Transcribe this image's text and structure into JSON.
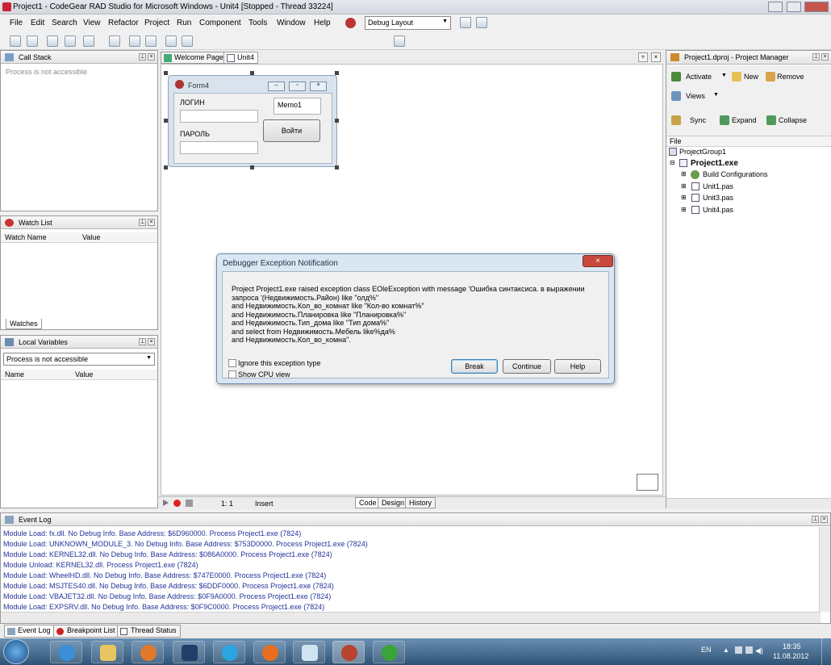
{
  "app": {
    "title": "Project1 - CodeGear RAD Studio for Microsoft Windows - Unit4 [Stopped - Thread 33224]"
  },
  "menu": [
    "File",
    "Edit",
    "Search",
    "View",
    "Refactor",
    "Project",
    "Run",
    "Component",
    "Tools",
    "Window",
    "Help"
  ],
  "layout_combo": "Debug Layout",
  "call_stack": {
    "title": "Call Stack",
    "message": "Process is not accessible"
  },
  "watch_list": {
    "title": "Watch List",
    "col_name": "Watch Name",
    "col_value": "Value",
    "tab": "Watches"
  },
  "local_vars": {
    "title": "Local Variables",
    "combo": "Process is not accessible",
    "col_name": "Name",
    "col_value": "Value"
  },
  "editor_tabs": {
    "welcome": "Welcome Page",
    "unit": "Unit4"
  },
  "form": {
    "title": "Form4",
    "login_label": "ЛОГИН",
    "password_label": "ПАРОЛЬ",
    "memo": "Memo1",
    "button": "Войти"
  },
  "editor_status": {
    "position": "1:   1",
    "mode": "Insert",
    "tab_code": "Code",
    "tab_design": "Design",
    "tab_history": "History"
  },
  "dialog": {
    "title": "Debugger Exception Notification",
    "lines": [
      "Project Project1.exe raised exception class EOleException with message 'Ошибка синтаксиса. в выражении",
      "запроса '(Недвижимость.Район) like \"олд%\"",
      "and Недвижимость.Кол_во_комнат like \"Кол-во комнат%\"",
      "and Недвижимость.Планировка like \"Планировка%\"",
      "and Недвижимость.Тип_дома like \"Тип дома%\"",
      "and select from Недвижимость.Мебель like%да%",
      "and Недвижимость.Кол_во_комна\"."
    ],
    "ignore_label": "Ignore this exception type",
    "cpu_label": "Show CPU view",
    "break": "Break",
    "continue": "Continue",
    "help": "Help"
  },
  "project_manager": {
    "title": "Project1.dproj - Project Manager",
    "activate": "Activate",
    "new": "New",
    "remove": "Remove",
    "views": "Views",
    "sync": "Sync",
    "expand": "Expand",
    "collapse": "Collapse",
    "col_file": "File",
    "tree": {
      "group": "ProjectGroup1",
      "project": "Project1.exe",
      "build": "Build Configurations",
      "u1": "Unit1.pas",
      "u3": "Unit3.pas",
      "u4": "Unit4.pas"
    }
  },
  "event_log": {
    "title": "Event Log",
    "lines": [
      "Module Load: fx.dll. No Debug Info. Base Address: $6D960000. Process Project1.exe (7824)",
      "Module Load: UNKNOWN_MODULE_3. No Debug Info. Base Address: $753D0000. Process Project1.exe (7824)",
      "Module Load: KERNEL32.dll. No Debug Info. Base Address: $086A0000. Process Project1.exe (7824)",
      "Module Unload: KERNEL32.dll. Process Project1.exe (7824)",
      "Module Load: WheelHD.dll. No Debug Info. Base Address: $747E0000. Process Project1.exe (7824)",
      "Module Load: MSJTES40.dll. No Debug Info. Base Address: $6DDF0000. Process Project1.exe (7824)",
      "Module Load: VBAJET32.dll. No Debug Info. Base Address: $0F9A0000. Process Project1.exe (7824)",
      "Module Load: EXPSRV.dll. No Debug Info. Base Address: $0F9C0000. Process Project1.exe (7824)"
    ],
    "tabs": [
      "Event Log",
      "Breakpoint List",
      "Thread Status"
    ]
  },
  "taskbar": {
    "lang": "EN",
    "time": "18:35",
    "date": "11.08.2012"
  }
}
